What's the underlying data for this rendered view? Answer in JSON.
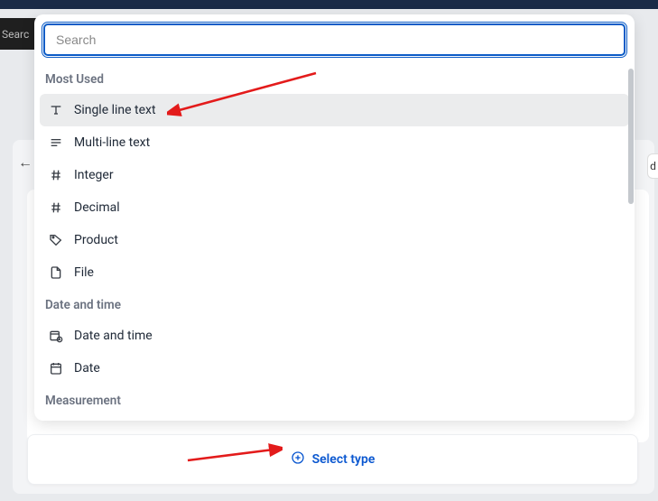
{
  "bg": {
    "searchFragment": "Searc",
    "rightStub": "d"
  },
  "dropdown": {
    "searchPlaceholder": "Search",
    "groups": [
      {
        "label": "Most Used",
        "items": [
          {
            "icon": "text-icon",
            "label": "Single line text",
            "selected": true
          },
          {
            "icon": "lines-icon",
            "label": "Multi-line text",
            "selected": false
          },
          {
            "icon": "hash-icon",
            "label": "Integer",
            "selected": false
          },
          {
            "icon": "hash-icon",
            "label": "Decimal",
            "selected": false
          },
          {
            "icon": "tag-icon",
            "label": "Product",
            "selected": false
          },
          {
            "icon": "file-icon",
            "label": "File",
            "selected": false
          }
        ]
      },
      {
        "label": "Date and time",
        "items": [
          {
            "icon": "calendar-clock-icon",
            "label": "Date and time",
            "selected": false
          },
          {
            "icon": "calendar-icon",
            "label": "Date",
            "selected": false
          }
        ]
      },
      {
        "label": "Measurement",
        "items": []
      }
    ]
  },
  "footer": {
    "selectTypeLabel": "Select type"
  },
  "colors": {
    "accent": "#0a57d0",
    "arrow": "#e31b1b"
  }
}
